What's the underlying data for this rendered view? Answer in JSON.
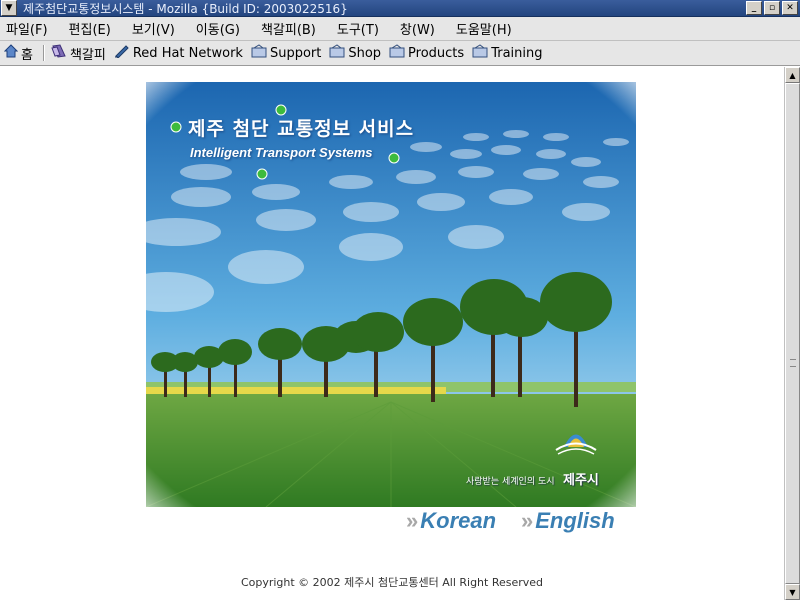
{
  "window": {
    "title": "제주첨단교통정보시스템 - Mozilla {Build ID: 2003022516}",
    "controls": [
      "minimize",
      "maximize",
      "close"
    ]
  },
  "menubar": {
    "items": [
      "파일(F)",
      "편집(E)",
      "보기(V)",
      "이동(G)",
      "책갈피(B)",
      "도구(T)",
      "창(W)",
      "도움말(H)"
    ]
  },
  "toolbar": {
    "home_label": "홈",
    "bookmarks_label": "책갈피",
    "links": [
      "Red Hat Network",
      "Support",
      "Shop",
      "Products",
      "Training"
    ]
  },
  "hero": {
    "title_ko": "제주 첨단 교통정보 서비스",
    "title_en": "Intelligent Transport Systems",
    "slogan": "사랑받는 세계인의 도시",
    "city": "제주시"
  },
  "languages": {
    "korean": "Korean",
    "english": "English",
    "chevron": "»"
  },
  "footer": {
    "copyright": "Copyright © 2002 제주시 첨단교통센터 All Right Reserved"
  },
  "colors": {
    "titlebar": "#23457f",
    "sky_top": "#1f6fb8",
    "sky_bottom": "#bfe2f5",
    "grass": "#3f8a2a",
    "lang_link": "#3a7fb3"
  }
}
